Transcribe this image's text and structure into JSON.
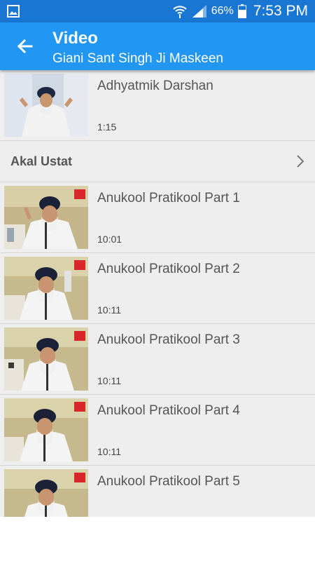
{
  "status_bar": {
    "battery_percent": "66%",
    "time": "7:53 PM"
  },
  "app_bar": {
    "title": "Video",
    "subtitle": "Giani Sant Singh Ji Maskeen"
  },
  "list": {
    "top_item": {
      "title": "Adhyatmik Darshan",
      "duration": "1:15"
    },
    "section": {
      "label": "Akal Ustat"
    },
    "videos": [
      {
        "title": "Anukool Pratikool Part 1",
        "duration": "10:01"
      },
      {
        "title": "Anukool Pratikool Part 2",
        "duration": "10:11"
      },
      {
        "title": "Anukool Pratikool Part 3",
        "duration": "10:11"
      },
      {
        "title": "Anukool Pratikool Part 4",
        "duration": "10:11"
      },
      {
        "title": "Anukool Pratikool Part 5",
        "duration": ""
      }
    ]
  },
  "colors": {
    "status_bar": "#1976d2",
    "app_bar": "#2196f3",
    "list_background": "#eeeeee"
  }
}
